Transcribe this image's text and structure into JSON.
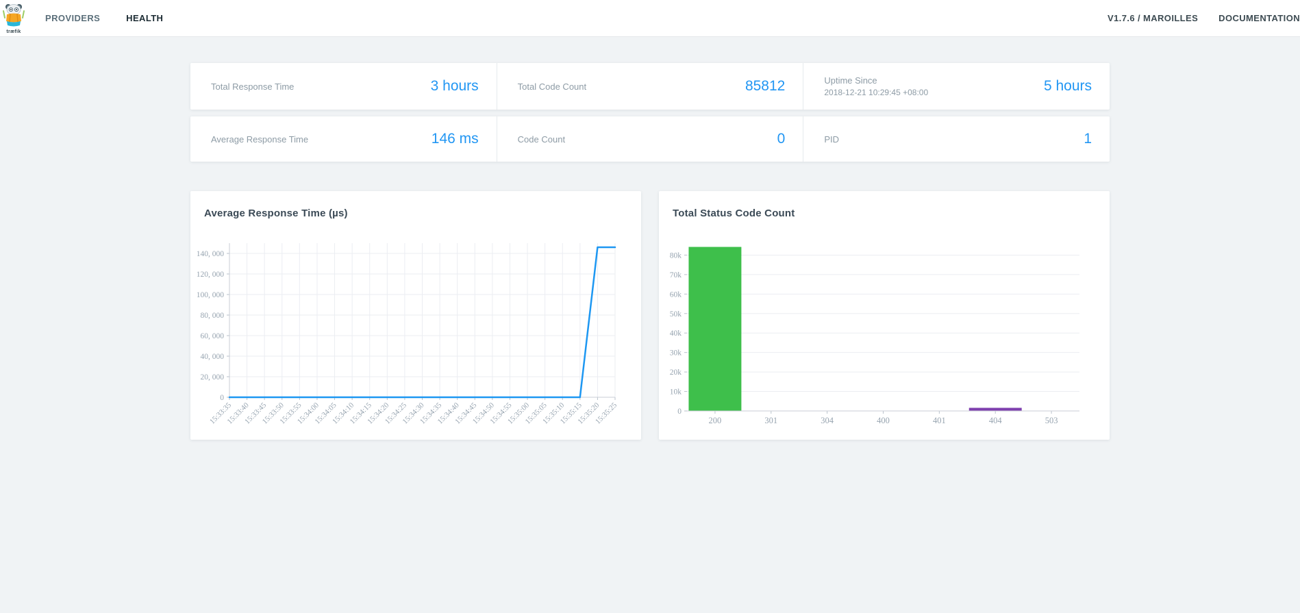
{
  "accent_color": "#2196f3",
  "navbar": {
    "logo_text": "træfik",
    "links": [
      {
        "label": "PROVIDERS",
        "active": false
      },
      {
        "label": "HEALTH",
        "active": true
      }
    ],
    "version_label": "V1.7.6 / MAROILLES",
    "docs_label": "DOCUMENTATION"
  },
  "stats": {
    "rows": [
      [
        {
          "label": "Total Response Time",
          "sublabel": "",
          "value": "3 hours"
        },
        {
          "label": "Total Code Count",
          "sublabel": "",
          "value": "85812"
        },
        {
          "label": "Uptime Since",
          "sublabel": "2018-12-21 10:29:45 +08:00",
          "value": "5 hours"
        }
      ],
      [
        {
          "label": "Average Response Time",
          "sublabel": "",
          "value": "146 ms"
        },
        {
          "label": "Code Count",
          "sublabel": "",
          "value": "0"
        },
        {
          "label": "PID",
          "sublabel": "",
          "value": "1"
        }
      ]
    ]
  },
  "chart_data": [
    {
      "type": "line",
      "title": "Average Response Time (µs)",
      "x": [
        "15:33:35",
        "15:33:40",
        "15:33:45",
        "15:33:50",
        "15:33:55",
        "15:34:00",
        "15:34:05",
        "15:34:10",
        "15:34:15",
        "15:34:20",
        "15:34:25",
        "15:34:30",
        "15:34:35",
        "15:34:40",
        "15:34:45",
        "15:34:50",
        "15:34:55",
        "15:35:00",
        "15:35:05",
        "15:35:10",
        "15:35:15",
        "15:35:20",
        "15:35:25"
      ],
      "values": [
        0,
        0,
        0,
        0,
        0,
        0,
        0,
        0,
        0,
        0,
        0,
        0,
        0,
        0,
        0,
        0,
        0,
        0,
        0,
        0,
        0,
        146000,
        146000
      ],
      "ylim": [
        0,
        150000
      ],
      "yticks": [
        0,
        20000,
        40000,
        60000,
        80000,
        100000,
        120000,
        140000
      ],
      "ytick_labels": [
        "0",
        "20, 000",
        "40, 000",
        "60, 000",
        "80, 000",
        "100, 000",
        "120, 000",
        "140, 000"
      ],
      "line_color": "#1d97f2",
      "grid": "both",
      "legend": "none",
      "xlabel": "",
      "ylabel": ""
    },
    {
      "type": "bar",
      "title": "Total Status Code Count",
      "categories": [
        "200",
        "301",
        "304",
        "400",
        "401",
        "404",
        "503"
      ],
      "values": [
        84200,
        0,
        0,
        0,
        0,
        1600,
        0
      ],
      "bar_colors": [
        "#3ebf4b",
        "#3ebf4b",
        "#3ebf4b",
        "#3ebf4b",
        "#3ebf4b",
        "#7e3fae",
        "#3ebf4b"
      ],
      "ylim": [
        0,
        90000
      ],
      "yticks": [
        0,
        10000,
        20000,
        30000,
        40000,
        50000,
        60000,
        70000,
        80000
      ],
      "ytick_labels": [
        "0",
        "10k",
        "20k",
        "30k",
        "40k",
        "50k",
        "60k",
        "70k",
        "80k"
      ],
      "grid": "horizontal",
      "legend": "none",
      "xlabel": "",
      "ylabel": ""
    }
  ]
}
